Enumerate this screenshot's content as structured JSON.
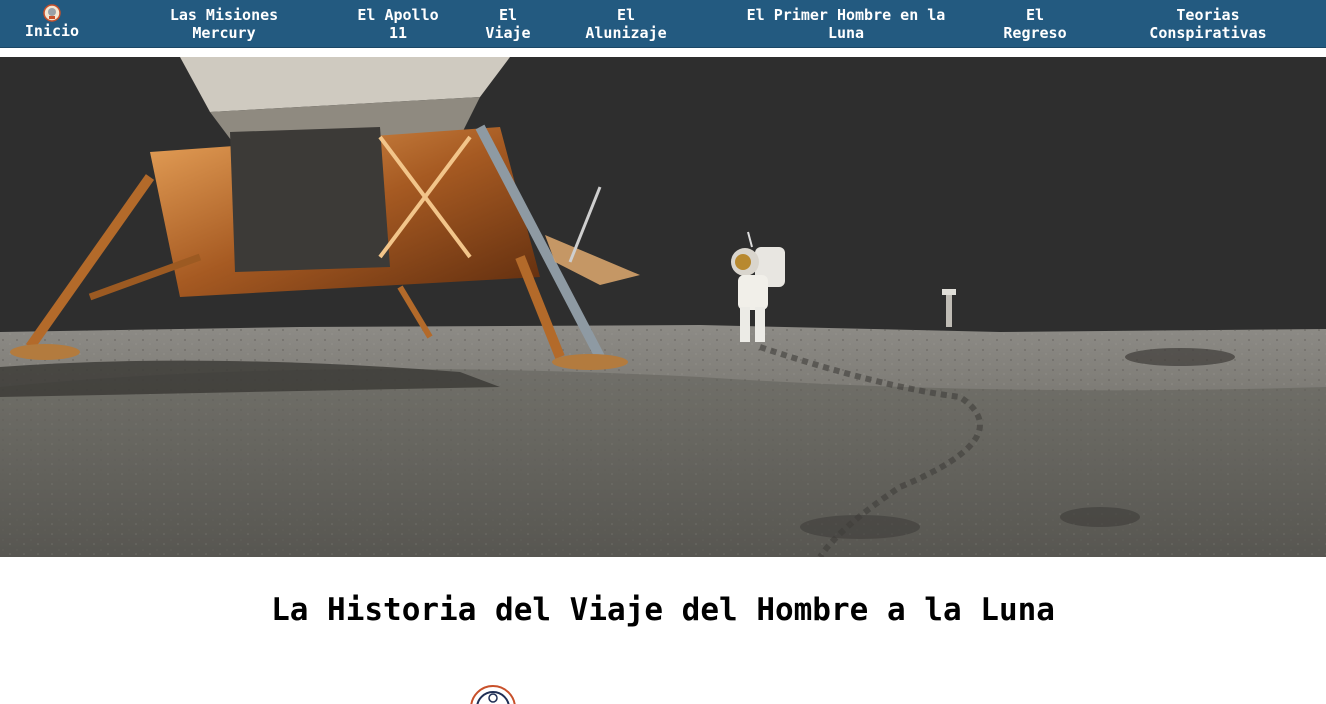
{
  "nav": {
    "home_label": "Inicio",
    "items": [
      {
        "line1": "Las Misiones",
        "line2": "Mercury"
      },
      {
        "line1": "El Apollo",
        "line2": "11"
      },
      {
        "line1": "El",
        "line2": "Viaje"
      },
      {
        "line1": "El",
        "line2": "Alunizaje"
      },
      {
        "line1": "El Primer Hombre en la",
        "line2": "Luna"
      },
      {
        "line1": "El",
        "line2": "Regreso"
      },
      {
        "line1": "Teorias",
        "line2": "Conspirativas"
      }
    ]
  },
  "hero": {
    "image_icon": "apollo-lunar-surface-photo"
  },
  "main": {
    "title": "La Historia del Viaje del Hombre a la Luna"
  },
  "colors": {
    "nav_bg": "#235a80",
    "nav_text": "#ffffff",
    "logo_accent": "#c8502a"
  }
}
